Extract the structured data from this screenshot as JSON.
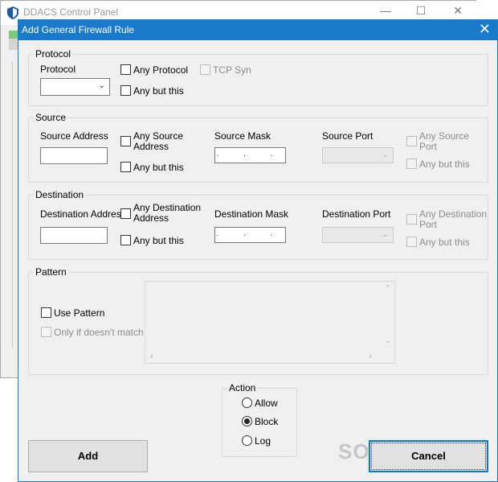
{
  "background_window": {
    "title": "DDACS Control Panel"
  },
  "dialog": {
    "title": "Add General Firewall Rule",
    "protocol": {
      "group_label": "Protocol",
      "field_label": "Protocol",
      "any_protocol": "Any Protocol",
      "any_but_this": "Any but this",
      "tcp_syn": "TCP Syn"
    },
    "source": {
      "group_label": "Source",
      "address_label": "Source Address",
      "any_address_line1": "Any Source",
      "any_address_line2": "Address",
      "any_but_this": "Any but this",
      "mask_label": "Source Mask",
      "mask_value": ". . .",
      "port_label": "Source Port",
      "any_port_line1": "Any Source",
      "any_port_line2": "Port",
      "port_any_but_this": "Any but this"
    },
    "destination": {
      "group_label": "Destination",
      "address_label": "Destination Address",
      "any_address_line1": "Any Destination",
      "any_address_line2": "Address",
      "any_but_this": "Any but this",
      "mask_label": "Destination Mask",
      "mask_value": ". . .",
      "port_label": "Destination Port",
      "any_port_line1": "Any Destination",
      "any_port_line2": "Port",
      "port_any_but_this": "Any but this"
    },
    "pattern": {
      "group_label": "Pattern",
      "use_pattern": "Use Pattern",
      "only_if_not_match": "Only if doesn't match"
    },
    "action": {
      "group_label": "Action",
      "options": [
        "Allow",
        "Block",
        "Log"
      ],
      "selected": "Block"
    },
    "buttons": {
      "add": "Add",
      "cancel": "Cancel"
    },
    "watermark": "SOFTPEDIA"
  },
  "colors": {
    "title_bar": "#1979ca",
    "dialog_bg": "#f0f0f0",
    "default_button_border": "#0078d7"
  }
}
